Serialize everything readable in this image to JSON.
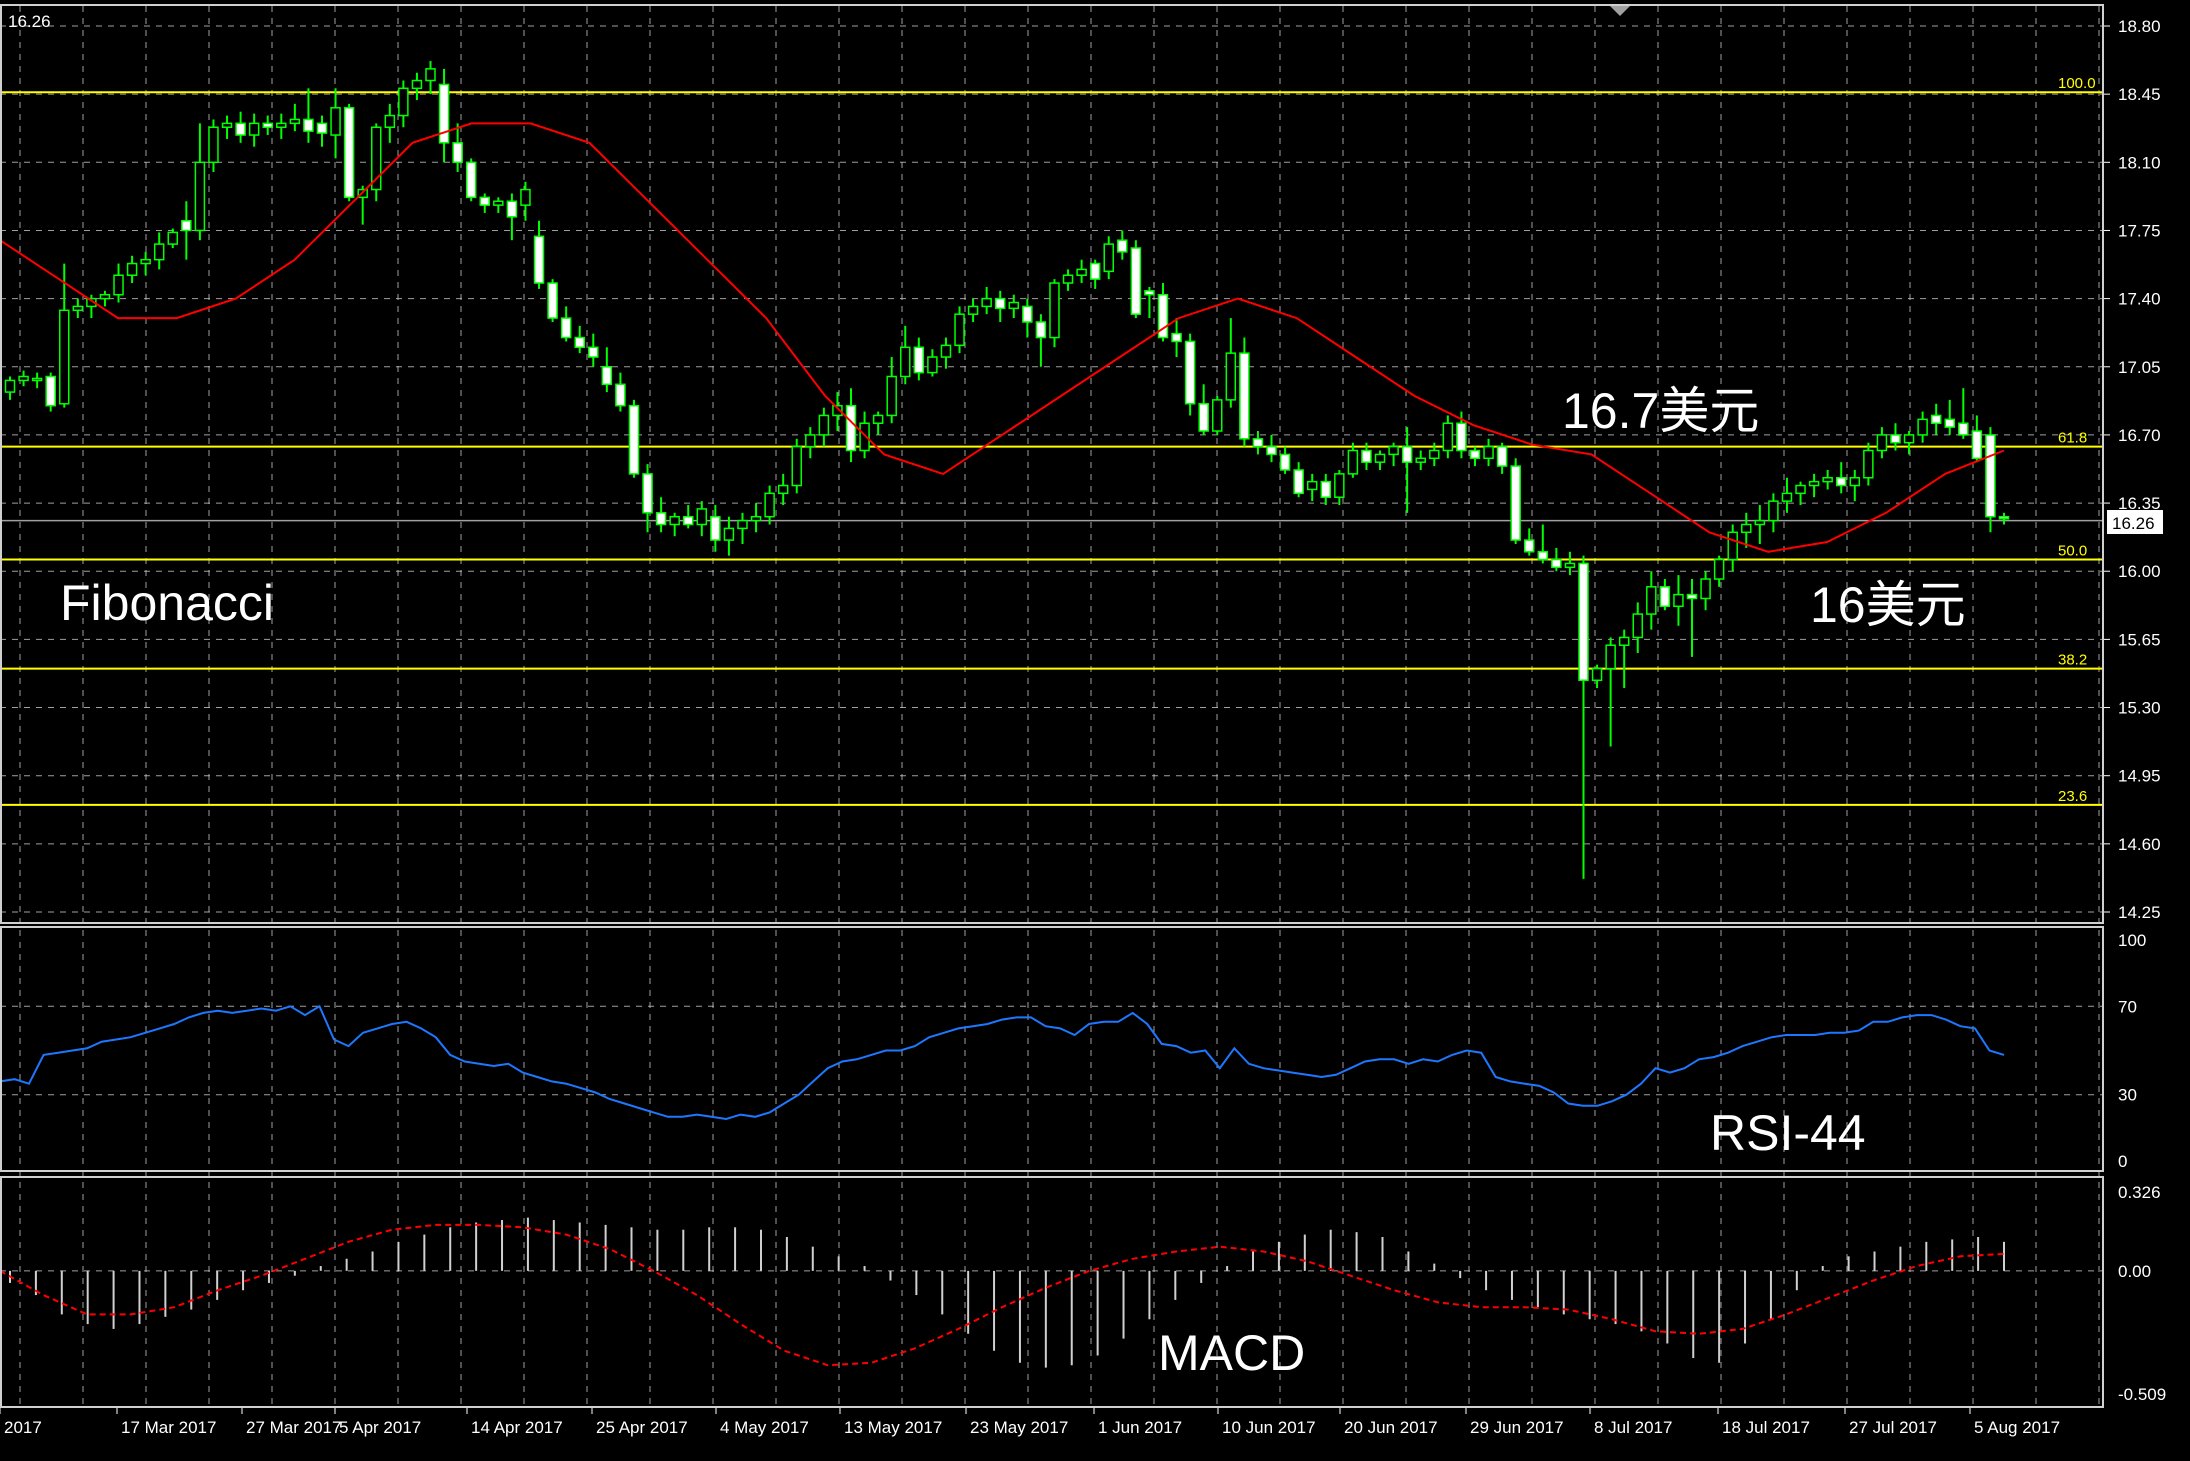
{
  "colors": {
    "background": "#000000",
    "grid": "#c8c8c8",
    "candle_up": "#00ff00",
    "candle_down": "#00ff00",
    "candle_up_fill": "#000000",
    "candle_down_fill": "#ffffff",
    "ma_line": "#ff0000",
    "fib_line": "#ffff00",
    "rsi_line": "#1e78ff",
    "macd_hist": "#d0d0d0",
    "macd_signal": "#ff0000",
    "price_line": "#a0a0a0"
  },
  "top_left_price": "16.26",
  "current_price_label": "16.26",
  "chart_data": [
    {
      "type": "candlestick",
      "title": "",
      "ylim": [
        14.25,
        18.8
      ],
      "y_ticks": [
        "18.80",
        "18.45",
        "18.10",
        "17.75",
        "17.40",
        "17.05",
        "16.70",
        "16.35",
        "16.00",
        "15.65",
        "15.30",
        "14.95",
        "14.60",
        "14.25"
      ],
      "x_ticks": [
        "2017",
        "17 Mar 2017",
        "27 Mar 2017",
        "5 Apr 2017",
        "14 Apr 2017",
        "25 Apr 2017",
        "4 May 2017",
        "13 May 2017",
        "23 May 2017",
        "1 Jun 2017",
        "10 Jun 2017",
        "20 Jun 2017",
        "29 Jun 2017",
        "8 Jul 2017",
        "18 Jul 2017",
        "27 Jul 2017",
        "5 Aug 2017"
      ],
      "fibonacci_levels": [
        {
          "label": "100.0",
          "value": 18.46
        },
        {
          "label": "61.8",
          "value": 16.64
        },
        {
          "label": "50.0",
          "value": 16.06
        },
        {
          "label": "38.2",
          "value": 15.5
        },
        {
          "label": "23.6",
          "value": 14.8
        }
      ],
      "annotations": [
        "Fibonacci",
        "16.7美元",
        "16美元"
      ],
      "candles": [
        [
          16.92,
          17.0,
          16.88,
          16.98
        ],
        [
          16.98,
          17.03,
          16.95,
          17.0
        ],
        [
          16.98,
          17.02,
          16.94,
          16.99
        ],
        [
          17.0,
          17.02,
          16.82,
          16.85
        ],
        [
          16.86,
          17.58,
          16.84,
          17.34
        ],
        [
          17.34,
          17.4,
          17.3,
          17.36
        ],
        [
          17.36,
          17.42,
          17.3,
          17.4
        ],
        [
          17.4,
          17.44,
          17.36,
          17.42
        ],
        [
          17.42,
          17.58,
          17.38,
          17.52
        ],
        [
          17.52,
          17.62,
          17.48,
          17.58
        ],
        [
          17.58,
          17.64,
          17.52,
          17.6
        ],
        [
          17.6,
          17.74,
          17.55,
          17.68
        ],
        [
          17.68,
          17.76,
          17.66,
          17.74
        ],
        [
          17.8,
          17.9,
          17.6,
          17.75
        ],
        [
          17.75,
          18.3,
          17.7,
          18.1
        ],
        [
          18.1,
          18.32,
          18.05,
          18.28
        ],
        [
          18.28,
          18.34,
          18.22,
          18.3
        ],
        [
          18.3,
          18.36,
          18.2,
          18.24
        ],
        [
          18.24,
          18.35,
          18.18,
          18.3
        ],
        [
          18.3,
          18.34,
          18.24,
          18.28
        ],
        [
          18.28,
          18.35,
          18.22,
          18.3
        ],
        [
          18.3,
          18.4,
          18.26,
          18.32
        ],
        [
          18.32,
          18.48,
          18.2,
          18.26
        ],
        [
          18.3,
          18.34,
          18.18,
          18.25
        ],
        [
          18.24,
          18.48,
          18.12,
          18.38
        ],
        [
          18.38,
          18.4,
          17.9,
          17.92
        ],
        [
          17.92,
          17.98,
          17.78,
          17.96
        ],
        [
          17.96,
          18.3,
          17.9,
          18.28
        ],
        [
          18.28,
          18.4,
          18.2,
          18.34
        ],
        [
          18.34,
          18.52,
          18.28,
          18.48
        ],
        [
          18.48,
          18.56,
          18.42,
          18.52
        ],
        [
          18.52,
          18.62,
          18.45,
          18.58
        ],
        [
          18.5,
          18.58,
          18.1,
          18.2
        ],
        [
          18.2,
          18.3,
          18.05,
          18.1
        ],
        [
          18.1,
          18.12,
          17.9,
          17.92
        ],
        [
          17.92,
          17.94,
          17.84,
          17.88
        ],
        [
          17.88,
          17.92,
          17.84,
          17.9
        ],
        [
          17.9,
          17.94,
          17.7,
          17.82
        ],
        [
          17.88,
          18.0,
          17.8,
          17.96
        ],
        [
          17.72,
          17.8,
          17.45,
          17.48
        ],
        [
          17.48,
          17.5,
          17.28,
          17.3
        ],
        [
          17.3,
          17.36,
          17.18,
          17.2
        ],
        [
          17.2,
          17.26,
          17.12,
          17.15
        ],
        [
          17.15,
          17.22,
          17.05,
          17.1
        ],
        [
          17.05,
          17.15,
          16.92,
          16.96
        ],
        [
          16.96,
          17.02,
          16.82,
          16.85
        ],
        [
          16.85,
          16.88,
          16.48,
          16.5
        ],
        [
          16.5,
          16.55,
          16.2,
          16.3
        ],
        [
          16.3,
          16.38,
          16.2,
          16.24
        ],
        [
          16.24,
          16.3,
          16.18,
          16.28
        ],
        [
          16.28,
          16.34,
          16.22,
          16.24
        ],
        [
          16.24,
          16.36,
          16.18,
          16.32
        ],
        [
          16.28,
          16.34,
          16.1,
          16.16
        ],
        [
          16.16,
          16.28,
          16.08,
          16.22
        ],
        [
          16.22,
          16.3,
          16.14,
          16.26
        ],
        [
          16.26,
          16.35,
          16.2,
          16.28
        ],
        [
          16.28,
          16.44,
          16.24,
          16.4
        ],
        [
          16.4,
          16.5,
          16.34,
          16.44
        ],
        [
          16.44,
          16.68,
          16.4,
          16.64
        ],
        [
          16.64,
          16.74,
          16.58,
          16.7
        ],
        [
          16.7,
          16.84,
          16.64,
          16.8
        ],
        [
          16.8,
          16.92,
          16.72,
          16.85
        ],
        [
          16.85,
          16.94,
          16.56,
          16.62
        ],
        [
          16.62,
          16.82,
          16.58,
          16.76
        ],
        [
          16.76,
          16.82,
          16.7,
          16.8
        ],
        [
          16.8,
          17.1,
          16.76,
          17.0
        ],
        [
          17.0,
          17.26,
          16.96,
          17.15
        ],
        [
          17.15,
          17.2,
          16.98,
          17.02
        ],
        [
          17.02,
          17.14,
          17.0,
          17.1
        ],
        [
          17.1,
          17.2,
          17.04,
          17.16
        ],
        [
          17.16,
          17.36,
          17.12,
          17.32
        ],
        [
          17.32,
          17.4,
          17.28,
          17.36
        ],
        [
          17.36,
          17.46,
          17.32,
          17.4
        ],
        [
          17.4,
          17.44,
          17.28,
          17.35
        ],
        [
          17.35,
          17.42,
          17.3,
          17.38
        ],
        [
          17.36,
          17.4,
          17.2,
          17.28
        ],
        [
          17.28,
          17.32,
          17.05,
          17.2
        ],
        [
          17.2,
          17.5,
          17.15,
          17.48
        ],
        [
          17.48,
          17.55,
          17.44,
          17.52
        ],
        [
          17.52,
          17.6,
          17.48,
          17.55
        ],
        [
          17.58,
          17.6,
          17.45,
          17.5
        ],
        [
          17.54,
          17.72,
          17.5,
          17.68
        ],
        [
          17.7,
          17.75,
          17.6,
          17.64
        ],
        [
          17.66,
          17.7,
          17.3,
          17.32
        ],
        [
          17.44,
          17.46,
          17.3,
          17.42
        ],
        [
          17.42,
          17.48,
          17.18,
          17.2
        ],
        [
          17.22,
          17.3,
          17.1,
          17.18
        ],
        [
          17.18,
          17.22,
          16.8,
          16.86
        ],
        [
          16.86,
          16.96,
          16.7,
          16.72
        ],
        [
          16.72,
          16.9,
          16.7,
          16.88
        ],
        [
          16.88,
          17.3,
          16.84,
          17.12
        ],
        [
          17.12,
          17.2,
          16.64,
          16.68
        ],
        [
          16.68,
          16.72,
          16.6,
          16.64
        ],
        [
          16.64,
          16.7,
          16.56,
          16.6
        ],
        [
          16.6,
          16.64,
          16.5,
          16.52
        ],
        [
          16.52,
          16.56,
          16.38,
          16.4
        ],
        [
          16.42,
          16.5,
          16.36,
          16.46
        ],
        [
          16.46,
          16.5,
          16.34,
          16.38
        ],
        [
          16.38,
          16.52,
          16.34,
          16.5
        ],
        [
          16.5,
          16.66,
          16.48,
          16.62
        ],
        [
          16.62,
          16.66,
          16.52,
          16.56
        ],
        [
          16.56,
          16.62,
          16.52,
          16.6
        ],
        [
          16.6,
          16.66,
          16.54,
          16.64
        ],
        [
          16.64,
          16.74,
          16.3,
          16.56
        ],
        [
          16.56,
          16.62,
          16.52,
          16.58
        ],
        [
          16.58,
          16.66,
          16.54,
          16.62
        ],
        [
          16.62,
          16.8,
          16.58,
          16.76
        ],
        [
          16.76,
          16.82,
          16.58,
          16.62
        ],
        [
          16.62,
          16.64,
          16.54,
          16.58
        ],
        [
          16.58,
          16.68,
          16.54,
          16.64
        ],
        [
          16.64,
          16.66,
          16.5,
          16.54
        ],
        [
          16.54,
          16.58,
          16.14,
          16.16
        ],
        [
          16.16,
          16.22,
          16.08,
          16.1
        ],
        [
          16.1,
          16.24,
          16.04,
          16.06
        ],
        [
          16.06,
          16.12,
          16.0,
          16.02
        ],
        [
          16.02,
          16.1,
          15.98,
          16.04
        ],
        [
          16.04,
          16.08,
          14.42,
          15.44
        ],
        [
          15.44,
          15.52,
          15.4,
          15.5
        ],
        [
          15.5,
          15.66,
          15.1,
          15.62
        ],
        [
          15.62,
          15.7,
          15.4,
          15.66
        ],
        [
          15.66,
          15.84,
          15.58,
          15.78
        ],
        [
          15.78,
          16.0,
          15.7,
          15.92
        ],
        [
          15.92,
          15.96,
          15.8,
          15.82
        ],
        [
          15.82,
          15.98,
          15.72,
          15.88
        ],
        [
          15.88,
          15.96,
          15.56,
          15.86
        ],
        [
          15.86,
          16.0,
          15.8,
          15.96
        ],
        [
          15.96,
          16.08,
          15.92,
          16.06
        ],
        [
          16.06,
          16.24,
          16.0,
          16.2
        ],
        [
          16.2,
          16.3,
          16.12,
          16.24
        ],
        [
          16.24,
          16.34,
          16.14,
          16.26
        ],
        [
          16.26,
          16.4,
          16.2,
          16.36
        ],
        [
          16.36,
          16.48,
          16.3,
          16.4
        ],
        [
          16.4,
          16.46,
          16.34,
          16.44
        ],
        [
          16.44,
          16.5,
          16.38,
          16.46
        ],
        [
          16.46,
          16.52,
          16.42,
          16.48
        ],
        [
          16.48,
          16.56,
          16.4,
          16.44
        ],
        [
          16.44,
          16.52,
          16.36,
          16.48
        ],
        [
          16.48,
          16.66,
          16.44,
          16.62
        ],
        [
          16.62,
          16.74,
          16.58,
          16.7
        ],
        [
          16.7,
          16.76,
          16.62,
          16.66
        ],
        [
          16.66,
          16.72,
          16.6,
          16.7
        ],
        [
          16.7,
          16.82,
          16.66,
          16.78
        ],
        [
          16.8,
          16.86,
          16.7,
          16.76
        ],
        [
          16.78,
          16.88,
          16.7,
          16.74
        ],
        [
          16.76,
          16.94,
          16.68,
          16.7
        ],
        [
          16.72,
          16.8,
          16.56,
          16.58
        ],
        [
          16.7,
          16.74,
          16.2,
          16.28
        ],
        [
          16.28,
          16.3,
          16.24,
          16.27
        ]
      ],
      "ma": [
        17.7,
        17.5,
        17.3,
        17.3,
        17.4,
        17.6,
        17.9,
        18.2,
        18.3,
        18.3,
        18.2,
        17.9,
        17.6,
        17.3,
        16.9,
        16.6,
        16.5,
        16.7,
        16.9,
        17.1,
        17.3,
        17.4,
        17.3,
        17.1,
        16.9,
        16.75,
        16.65,
        16.6,
        16.4,
        16.2,
        16.1,
        16.15,
        16.3,
        16.5,
        16.62
      ]
    },
    {
      "type": "line",
      "title": "RSI-44",
      "ylim": [
        0,
        100
      ],
      "y_ticks": [
        "100",
        "70",
        "30",
        "0"
      ],
      "values": [
        36,
        37,
        35,
        48,
        49,
        50,
        51,
        54,
        55,
        56,
        58,
        60,
        62,
        65,
        67,
        68,
        67,
        68,
        69,
        68,
        70,
        66,
        70,
        55,
        52,
        58,
        60,
        62,
        63,
        60,
        56,
        48,
        45,
        44,
        43,
        44,
        40,
        38,
        36,
        35,
        33,
        31,
        28,
        26,
        24,
        22,
        20,
        20,
        21,
        20,
        19,
        21,
        20,
        22,
        26,
        30,
        36,
        42,
        45,
        46,
        48,
        50,
        50,
        52,
        56,
        58,
        60,
        61,
        62,
        64,
        65,
        65,
        61,
        60,
        57,
        62,
        63,
        63,
        67,
        62,
        53,
        52,
        49,
        50,
        42,
        51,
        44,
        42,
        41,
        40,
        39,
        38,
        39,
        42,
        45,
        46,
        46,
        44,
        46,
        45,
        48,
        50,
        49,
        38,
        36,
        35,
        34,
        31,
        26,
        25,
        25,
        27,
        30,
        35,
        42,
        40,
        42,
        46,
        47,
        49,
        52,
        54,
        56,
        57,
        57,
        57,
        58,
        58,
        59,
        63,
        63,
        65,
        66,
        66,
        64,
        61,
        60,
        50,
        48
      ]
    },
    {
      "type": "bar",
      "title": "MACD",
      "ylim": [
        -0.509,
        0.326
      ],
      "y_ticks": [
        "0.326",
        "0.00",
        "-0.509"
      ],
      "histogram": [
        -0.05,
        -0.1,
        -0.18,
        -0.22,
        -0.24,
        -0.22,
        -0.19,
        -0.16,
        -0.12,
        -0.08,
        -0.05,
        -0.02,
        0.02,
        0.05,
        0.08,
        0.12,
        0.15,
        0.18,
        0.2,
        0.21,
        0.22,
        0.21,
        0.2,
        0.19,
        0.18,
        0.17,
        0.17,
        0.18,
        0.18,
        0.17,
        0.14,
        0.1,
        0.06,
        0.02,
        -0.04,
        -0.1,
        -0.18,
        -0.26,
        -0.33,
        -0.38,
        -0.4,
        -0.39,
        -0.35,
        -0.28,
        -0.2,
        -0.12,
        -0.05,
        0.02,
        0.08,
        0.12,
        0.15,
        0.17,
        0.16,
        0.14,
        0.08,
        0.03,
        -0.03,
        -0.08,
        -0.12,
        -0.15,
        -0.18,
        -0.2,
        -0.22,
        -0.25,
        -0.3,
        -0.36,
        -0.38,
        -0.3,
        -0.2,
        -0.08,
        0.02,
        0.06,
        0.08,
        0.1,
        0.12,
        0.13,
        0.14,
        0.12
      ],
      "signal": [
        0.0,
        -0.1,
        -0.18,
        -0.18,
        -0.15,
        -0.08,
        -0.02,
        0.05,
        0.12,
        0.17,
        0.19,
        0.19,
        0.18,
        0.15,
        0.09,
        0.0,
        -0.1,
        -0.22,
        -0.33,
        -0.39,
        -0.38,
        -0.32,
        -0.24,
        -0.15,
        -0.07,
        0.0,
        0.05,
        0.08,
        0.1,
        0.08,
        0.04,
        -0.02,
        -0.08,
        -0.13,
        -0.15,
        -0.15,
        -0.16,
        -0.2,
        -0.25,
        -0.26,
        -0.24,
        -0.18,
        -0.11,
        -0.04,
        0.02,
        0.06,
        0.07
      ]
    }
  ]
}
